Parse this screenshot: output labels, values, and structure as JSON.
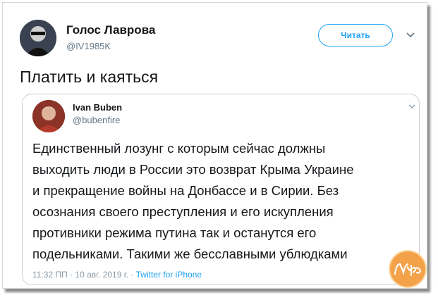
{
  "tweet": {
    "author_name": "Голос Лаврова",
    "author_handle": "@IV1985K",
    "follow_label": "Читать",
    "text": "Платить и каяться",
    "menu_icon": "chevron-down-icon"
  },
  "quoted_tweet": {
    "author_name": "Ivan Buben",
    "author_handle": "@bubenfire",
    "lines": [
      "Единственный лозунг с которым сейчас должны",
      "выходить люди в России это возврат Крыма Украине",
      "и прекращение войны на Донбассе и в Сирии. Без",
      "осознания своего преступления и его искупления",
      "противники режима путина так и останутся его",
      "подельниками. Такими же бесславными ублюдками"
    ],
    "timestamp": "11:32 ПП · 10 авг. 2019 г. · ",
    "source": "Twitter for iPhone",
    "menu_icon": "chevron-down-icon"
  },
  "watermark": {
    "text": "Nyka"
  }
}
